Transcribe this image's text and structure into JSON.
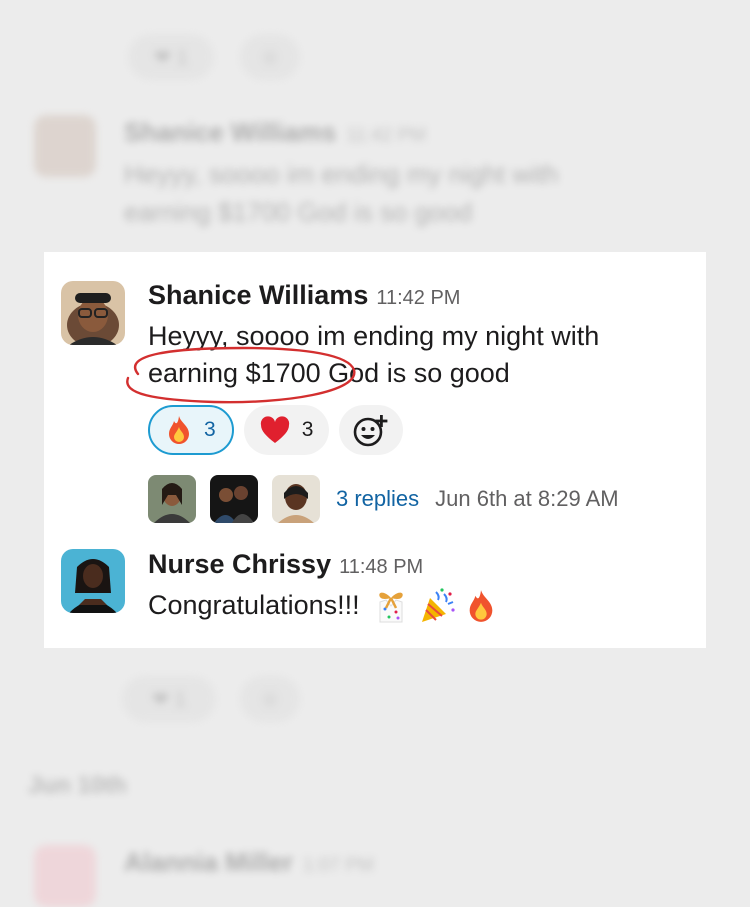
{
  "messages": [
    {
      "sender": "Shanice Williams",
      "time": "11:42 PM",
      "text_line1": "Heyyy, soooo im ending my night with",
      "text_line2": "earning $1700 God is so good",
      "reactions": [
        {
          "icon": "fire-emoji",
          "count": "3",
          "active": true
        },
        {
          "icon": "red-heart-emoji",
          "count": "3",
          "active": false
        }
      ],
      "add_reaction_icon": "add-reaction-icon",
      "thread": {
        "replies": "3 replies",
        "last_reply": "Jun 6th at 8:29 AM"
      }
    },
    {
      "sender": "Nurse Chrissy",
      "time": "11:48 PM",
      "text": "Congratulations!!!",
      "emojis": [
        "gift-emoji",
        "party-popper-emoji",
        "fire-emoji"
      ]
    }
  ],
  "colors": {
    "link": "#1264a3",
    "active_reaction_border": "#1d9bd1",
    "annotation_circle": "#d32f2f"
  }
}
